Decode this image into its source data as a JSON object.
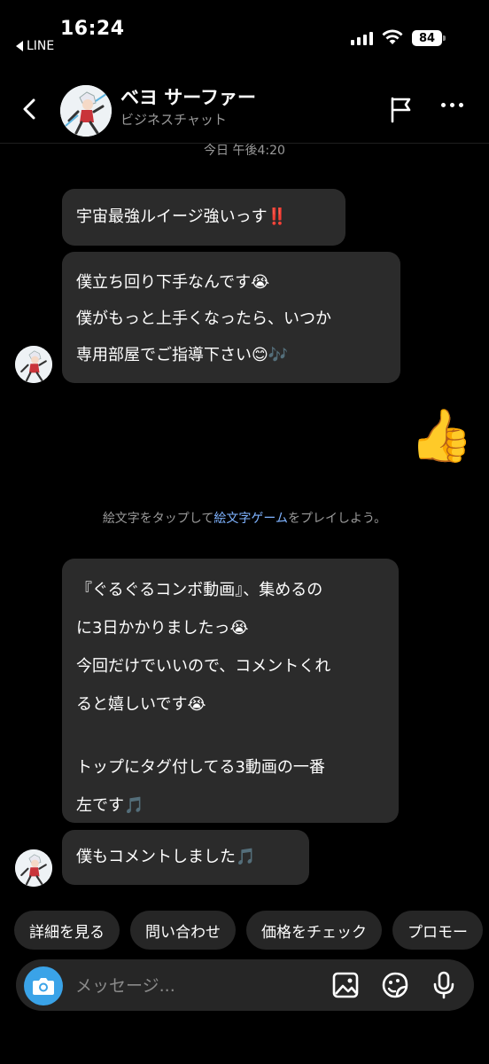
{
  "status": {
    "time": "16:24",
    "back_app": "LINE",
    "battery": "84"
  },
  "header": {
    "name": "ベヨ サーファー",
    "subtitle": "ビジネスチャット"
  },
  "chat": {
    "date_label": "今日 午後4:20",
    "msg1": {
      "text": "宇宙最強ルイージ強いっす",
      "emoji": "‼️"
    },
    "msg2": {
      "line1": "僕立ち回り下手なんです😭",
      "line2": "僕がもっと上手くなったら、いつか",
      "line3": "専用部屋でご指導下さい😊🎶"
    },
    "reply_emoji": "👍",
    "hint": {
      "before": "絵文字をタップして",
      "link": "絵文字ゲーム",
      "after": "をプレイしよう。"
    },
    "msg3": {
      "line1": "『ぐるぐるコンボ動画』、集めるの",
      "line2": "に3日かかりましたっ😭",
      "line3": "今回だけでいいので、コメントくれ",
      "line4": "ると嬉しいです😭",
      "line5": "トップにタグ付してる3動画の一番",
      "line6": "左です🎵"
    },
    "msg4": {
      "text": "僕もコメントしました🎵"
    }
  },
  "quick_replies": [
    "詳細を見る",
    "問い合わせ",
    "価格をチェック",
    "プロモー"
  ],
  "composer": {
    "placeholder": "メッセージ..."
  },
  "icons": {
    "back": "chevron-left-icon",
    "flag": "flag-icon",
    "more": "more-horizontal-icon",
    "camera": "camera-icon",
    "gallery": "image-icon",
    "sticker": "sticker-icon",
    "mic": "microphone-icon"
  },
  "colors": {
    "background": "#000000",
    "bubble": "#2b2b2b",
    "camera_button": "#3aa3e8",
    "link": "#7fb3ff"
  }
}
